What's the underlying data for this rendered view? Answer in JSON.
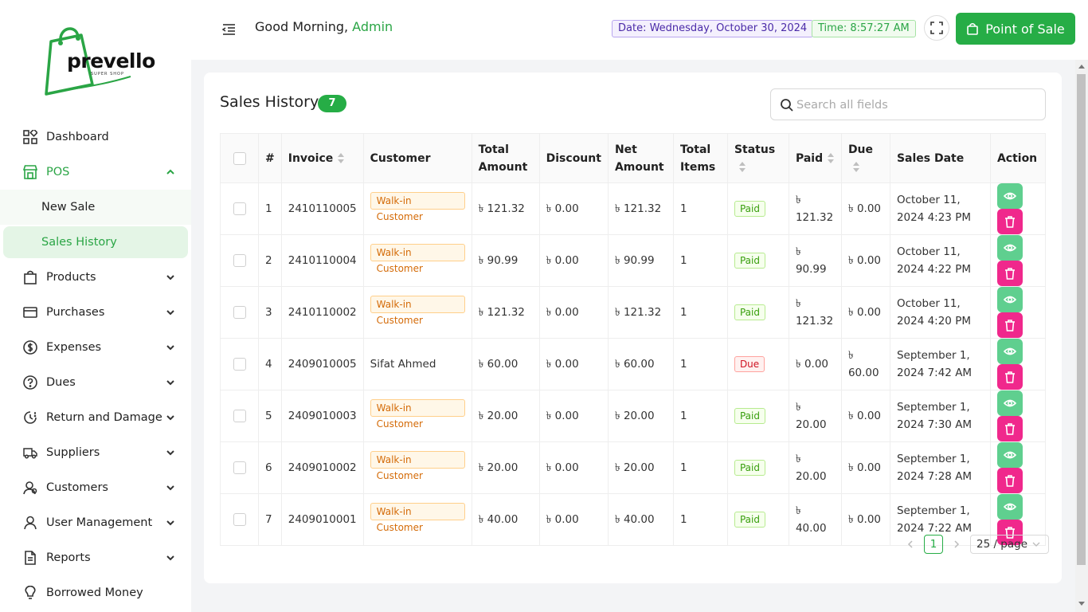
{
  "brand": {
    "name": "prevello",
    "tagline": "SUPER SHOP",
    "green": "#26ad46"
  },
  "sidebar": {
    "items": [
      {
        "label": "Dashboard",
        "icon": "dashboard-icon"
      },
      {
        "label": "POS",
        "icon": "store-icon",
        "expanded": true,
        "children": [
          {
            "label": "New Sale"
          },
          {
            "label": "Sales History",
            "selected": true
          }
        ]
      },
      {
        "label": "Products",
        "icon": "bag-icon"
      },
      {
        "label": "Purchases",
        "icon": "card-icon"
      },
      {
        "label": "Expenses",
        "icon": "dollar-icon"
      },
      {
        "label": "Dues",
        "icon": "question-icon"
      },
      {
        "label": "Return and Damage",
        "icon": "clock-alert-icon"
      },
      {
        "label": "Suppliers",
        "icon": "truck-icon"
      },
      {
        "label": "Customers",
        "icon": "users-icon"
      },
      {
        "label": "User Management",
        "icon": "user-icon"
      },
      {
        "label": "Reports",
        "icon": "document-icon"
      },
      {
        "label": "Borrowed Money",
        "icon": "bulb-icon"
      }
    ]
  },
  "header": {
    "greeting": "Good Morning,",
    "user": "Admin",
    "date": "Date: Wednesday, October 30, 2024",
    "time": "Time: 8:57:27 AM",
    "pos_button": "Point of Sale"
  },
  "page": {
    "title": "Sales History",
    "count": "7",
    "search_placeholder": "Search all fields"
  },
  "table": {
    "columns": [
      "#",
      "Invoice",
      "Customer",
      "Total Amount",
      "Discount",
      "Net Amount",
      "Total Items",
      "Status",
      "Paid",
      "Due",
      "Sales Date",
      "Action"
    ],
    "rows": [
      {
        "no": "1",
        "invoice": "2410110005",
        "customer": "Walk-in Customer",
        "walkin": true,
        "total": "৳ 121.32",
        "discount": "৳ 0.00",
        "net": "৳ 121.32",
        "items": "1",
        "status": "Paid",
        "paid": "৳ 121.32",
        "due": "৳ 0.00",
        "date": "October 11, 2024 4:23 PM"
      },
      {
        "no": "2",
        "invoice": "2410110004",
        "customer": "Walk-in Customer",
        "walkin": true,
        "total": "৳ 90.99",
        "discount": "৳ 0.00",
        "net": "৳ 90.99",
        "items": "1",
        "status": "Paid",
        "paid": "৳ 90.99",
        "due": "৳ 0.00",
        "date": "October 11, 2024 4:22 PM"
      },
      {
        "no": "3",
        "invoice": "2410110002",
        "customer": "Walk-in Customer",
        "walkin": true,
        "total": "৳ 121.32",
        "discount": "৳ 0.00",
        "net": "৳ 121.32",
        "items": "1",
        "status": "Paid",
        "paid": "৳ 121.32",
        "due": "৳ 0.00",
        "date": "October 11, 2024 4:20 PM"
      },
      {
        "no": "4",
        "invoice": "2409010005",
        "customer": "Sifat Ahmed",
        "walkin": false,
        "total": "৳ 60.00",
        "discount": "৳ 0.00",
        "net": "৳ 60.00",
        "items": "1",
        "status": "Due",
        "paid": "৳ 0.00",
        "due": "৳ 60.00",
        "date": "September 1, 2024 7:42 AM"
      },
      {
        "no": "5",
        "invoice": "2409010003",
        "customer": "Walk-in Customer",
        "walkin": true,
        "total": "৳ 20.00",
        "discount": "৳ 0.00",
        "net": "৳ 20.00",
        "items": "1",
        "status": "Paid",
        "paid": "৳ 20.00",
        "due": "৳ 0.00",
        "date": "September 1, 2024 7:30 AM"
      },
      {
        "no": "6",
        "invoice": "2409010002",
        "customer": "Walk-in Customer",
        "walkin": true,
        "total": "৳ 20.00",
        "discount": "৳ 0.00",
        "net": "৳ 20.00",
        "items": "1",
        "status": "Paid",
        "paid": "৳ 20.00",
        "due": "৳ 0.00",
        "date": "September 1, 2024 7:28 AM"
      },
      {
        "no": "7",
        "invoice": "2409010001",
        "customer": "Walk-in Customer",
        "walkin": true,
        "total": "৳ 40.00",
        "discount": "৳ 0.00",
        "net": "৳ 40.00",
        "items": "1",
        "status": "Paid",
        "paid": "৳ 40.00",
        "due": "৳ 0.00",
        "date": "September 1, 2024 7:22 AM"
      }
    ]
  },
  "pagination": {
    "current": "1",
    "page_size": "25 / page"
  }
}
